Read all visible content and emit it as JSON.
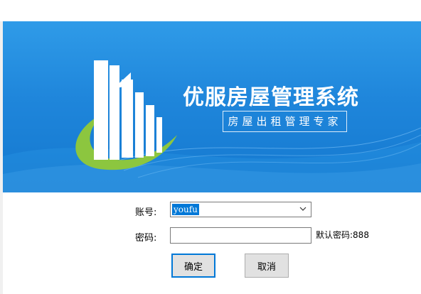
{
  "banner": {
    "title": "优服房屋管理系统",
    "subtitle": "房屋出租管理专家",
    "logo_icon": "building-logo-icon"
  },
  "login_form": {
    "account_label": "账号:",
    "account_value": "youfu",
    "password_label": "密码:",
    "password_value": "",
    "default_password_hint": "默认密码:888",
    "confirm_button": "确定",
    "cancel_button": "取消"
  },
  "colors": {
    "banner_blue": "#1f86db",
    "logo_green": "#8cc63f",
    "selection_blue": "#0078d7"
  }
}
